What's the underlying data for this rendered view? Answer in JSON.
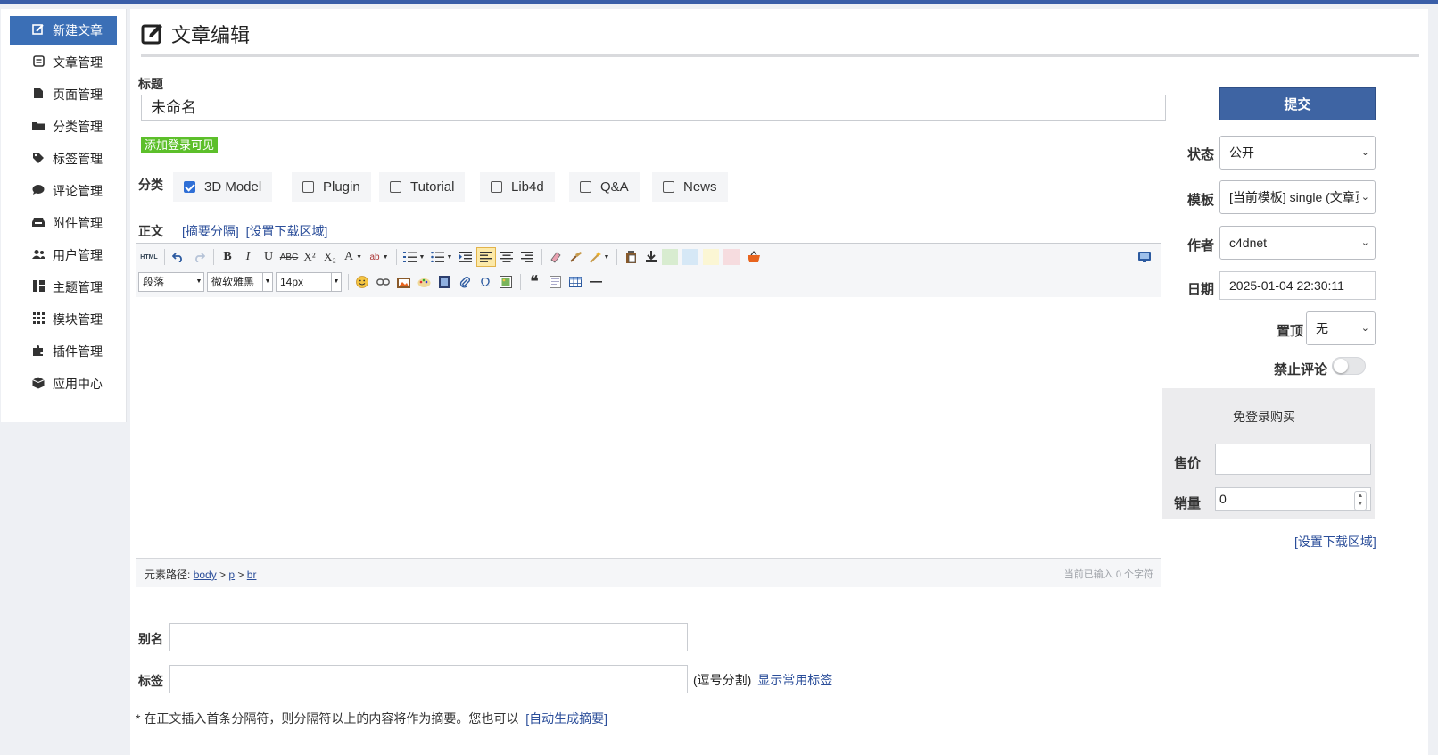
{
  "sidebar": {
    "items": [
      {
        "label": "新建文章",
        "icon": "edit-icon"
      },
      {
        "label": "文章管理",
        "icon": "article-icon"
      },
      {
        "label": "页面管理",
        "icon": "page-icon"
      },
      {
        "label": "分类管理",
        "icon": "folder-icon"
      },
      {
        "label": "标签管理",
        "icon": "tag-icon"
      },
      {
        "label": "评论管理",
        "icon": "comment-icon"
      },
      {
        "label": "附件管理",
        "icon": "attachment-icon"
      },
      {
        "label": "用户管理",
        "icon": "users-icon"
      },
      {
        "label": "主题管理",
        "icon": "theme-icon"
      },
      {
        "label": "模块管理",
        "icon": "modules-icon"
      },
      {
        "label": "插件管理",
        "icon": "puzzle-icon"
      },
      {
        "label": "应用中心",
        "icon": "box-icon"
      }
    ]
  },
  "header": {
    "title": "文章编辑"
  },
  "form": {
    "title_label": "标题",
    "title_value": "未命名",
    "login_visible_button": "添加登录可见",
    "category_label": "分类",
    "categories": [
      {
        "label": "3D Model",
        "checked": true
      },
      {
        "label": "Plugin",
        "checked": false
      },
      {
        "label": "Tutorial",
        "checked": false
      },
      {
        "label": "Lib4d",
        "checked": false
      },
      {
        "label": "Q&A",
        "checked": false
      },
      {
        "label": "News",
        "checked": false
      }
    ],
    "body_label": "正文",
    "summary_split_link": "[摘要分隔]",
    "download_area_link": "[设置下载区域]",
    "alias_label": "别名",
    "tags_label": "标签",
    "tags_hint": "(逗号分割)",
    "show_common_tags": "显示常用标签",
    "footnote": "* 在正文插入首条分隔符，则分隔符以上的内容将作为摘要。您也可以",
    "auto_summary_link": "[自动生成摘要]"
  },
  "editor": {
    "paragraph_select": "段落",
    "font_select": "微软雅黑",
    "size_select": "14px",
    "html_button": "HTML",
    "status_path_label": "元素路径:",
    "status_path": [
      "body",
      "p",
      "br"
    ],
    "status_count": "当前已输入 0 个字符",
    "swatch_colors": [
      "#d8ecd0",
      "#d6e8f6",
      "#fbf6d4",
      "#f6dcdf"
    ]
  },
  "right": {
    "submit_label": "提交",
    "status_label": "状态",
    "status_value": "公开",
    "template_label": "模板",
    "template_value": "[当前模板] single (文章页)",
    "author_label": "作者",
    "author_value": "c4dnet",
    "date_label": "日期",
    "date_value": "2025-01-04 22:30:11",
    "top_label": "置顶",
    "top_value": "无",
    "no_comment_label": "禁止评论",
    "no_comment_on": false,
    "buy_title": "免登录购买",
    "price_label": "售价",
    "price_value": "",
    "sales_label": "销量",
    "sales_value": "0",
    "download_area_link": "[设置下载区域]"
  },
  "colors": {
    "accent": "#3b6fb6",
    "submit": "#3e64a3",
    "badge_green": "#5cbf2a",
    "link": "#2b4e9a"
  }
}
